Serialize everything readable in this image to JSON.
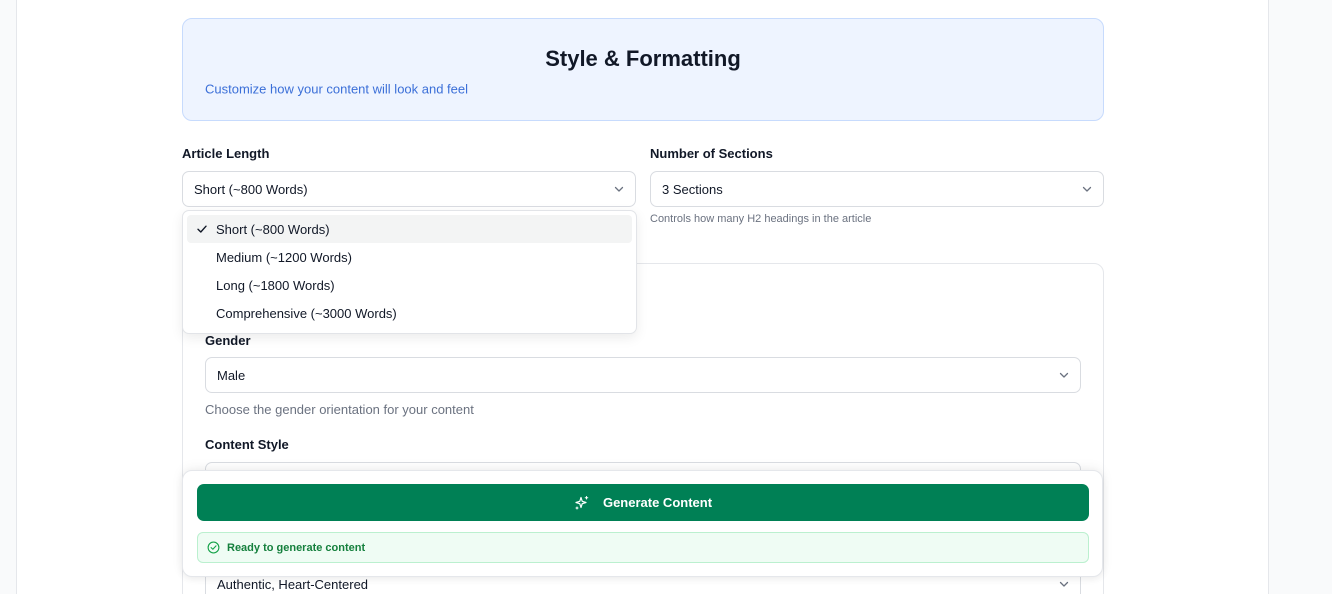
{
  "header": {
    "title": "Style & Formatting",
    "subtitle": "Customize how your content will look and feel"
  },
  "article_length": {
    "label": "Article Length",
    "value": "Short (~800 Words)",
    "options": [
      {
        "label": "Short (~800 Words)",
        "selected": true
      },
      {
        "label": "Medium (~1200 Words)",
        "selected": false
      },
      {
        "label": "Long (~1800 Words)",
        "selected": false
      },
      {
        "label": "Comprehensive (~3000 Words)",
        "selected": false
      }
    ]
  },
  "sections": {
    "label": "Number of Sections",
    "value": "3 Sections",
    "hint": "Controls how many H2 headings in the article"
  },
  "gender": {
    "label": "Gender",
    "value": "Male",
    "hint": "Choose the gender orientation for your content"
  },
  "content_style": {
    "label": "Content Style"
  },
  "tone": {
    "value": "Authentic, Heart-Centered"
  },
  "generate": {
    "button_label": "Generate Content",
    "status_text": "Ready to generate content"
  },
  "colors": {
    "primary_green": "#008055",
    "header_bg": "#eef4ff",
    "subtitle_blue": "#3b6fd8",
    "status_green": "#15803d"
  },
  "icons": {
    "dropdown": "chevron-down-icon",
    "check": "check-icon",
    "sparkles": "sparkles-icon",
    "status": "check-circle-icon"
  }
}
